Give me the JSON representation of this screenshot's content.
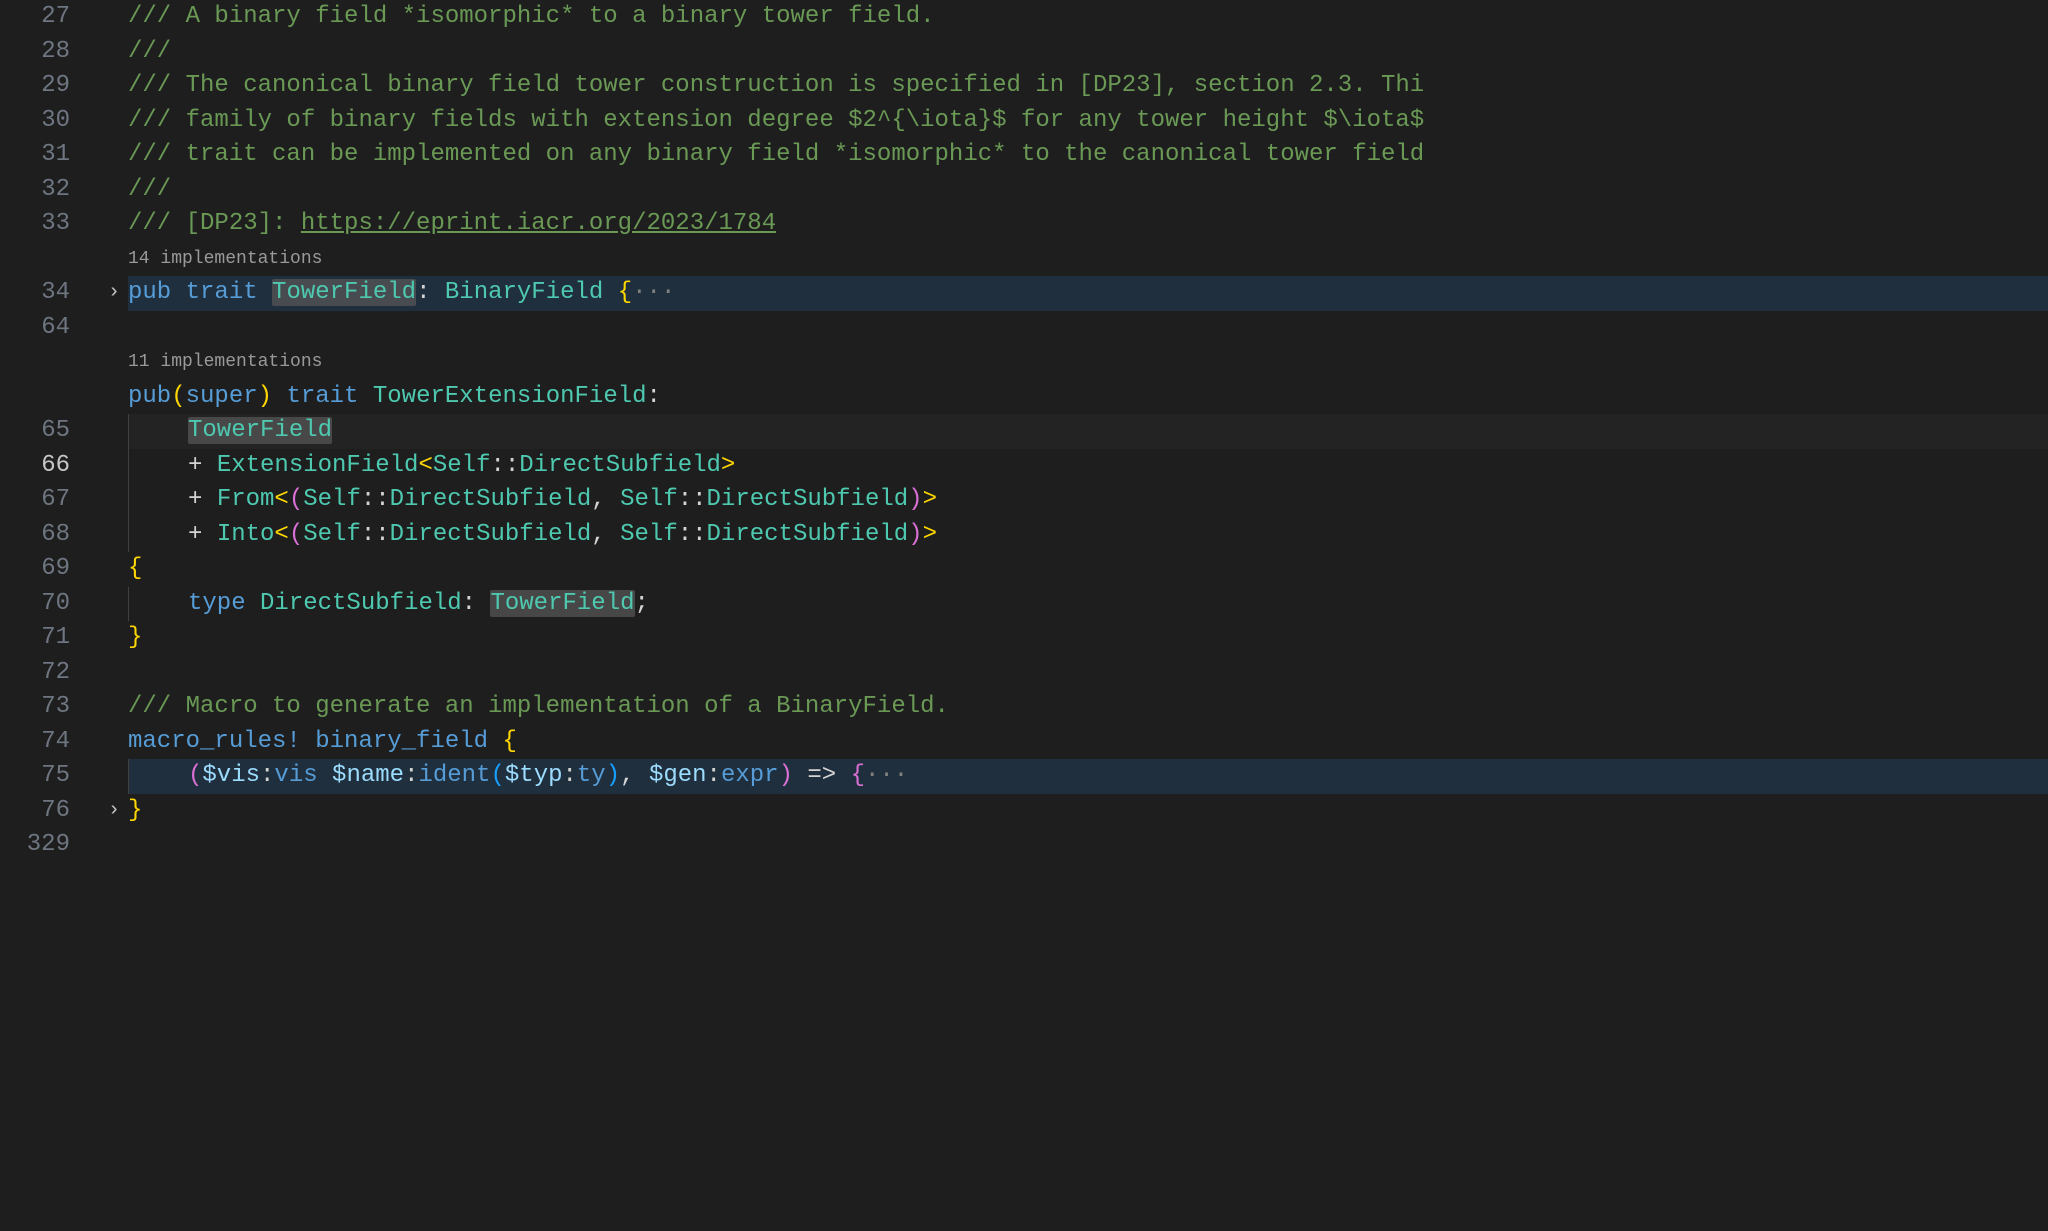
{
  "gutter": {
    "lines": [
      "27",
      "28",
      "29",
      "30",
      "31",
      "32",
      "33",
      "",
      "34",
      "64",
      "",
      "",
      "65",
      "66",
      "67",
      "68",
      "69",
      "70",
      "71",
      "72",
      "73",
      "74",
      "75",
      "76",
      "329"
    ],
    "activeIndex": 13
  },
  "fold": {
    "chevron": "›",
    "rows": [
      8,
      23
    ]
  },
  "codelens": {
    "impl14": "14 implementations",
    "impl11": "11 implementations"
  },
  "code": {
    "l27": "/// A binary field *isomorphic* to a binary tower field.",
    "l28": "///",
    "l29": "/// The canonical binary field tower construction is specified in [DP23], section 2.3. Thi",
    "l30": "/// family of binary fields with extension degree $2^{\\iota}$ for any tower height $\\iota$",
    "l31": "/// trait can be implemented on any binary field *isomorphic* to the canonical tower field",
    "l32": "///",
    "l33a": "/// [DP23]: ",
    "l33b": "https://eprint.iacr.org/2023/1784",
    "l34": {
      "pub": "pub",
      "trait": "trait",
      "name": "TowerField",
      "colon": ": ",
      "base": "BinaryField",
      "open": " {",
      "dots": "···"
    },
    "l65": {
      "pub": "pub",
      "po": "(",
      "super": "super",
      "pc": ")",
      "trait": " trait ",
      "name": "TowerExtensionField",
      "colon": ":"
    },
    "l66": "TowerField",
    "l67": {
      "plus": "+ ",
      "ext": "ExtensionField",
      "lt": "<",
      "self": "Self",
      "cc": "::",
      "dsub": "DirectSubfield",
      "gt": ">"
    },
    "l68": {
      "plus": "+ ",
      "from": "From",
      "lt": "<",
      "po": "(",
      "self": "Self",
      "cc": "::",
      "dsub": "DirectSubfield",
      "comma": ", ",
      "pc": ")",
      "gt": ">"
    },
    "l69": {
      "plus": "+ ",
      "into": "Into",
      "lt": "<",
      "po": "(",
      "self": "Self",
      "cc": "::",
      "dsub": "DirectSubfield",
      "comma": ", ",
      "pc": ")",
      "gt": ">"
    },
    "l70": "{",
    "l71": {
      "type": "type ",
      "name": "DirectSubfield",
      "colon": ": ",
      "tw": "TowerField",
      "semi": ";"
    },
    "l72": "}",
    "l74": "/// Macro to generate an implementation of a BinaryField.",
    "l75": {
      "mr": "macro_rules!",
      "sp": " ",
      "name": "binary_field",
      "sp2": " ",
      "open": "{"
    },
    "l76": {
      "po": "(",
      "d1": "$vis",
      "c1": ":",
      "k1": "vis",
      "sp": " ",
      "d2": "$name",
      "c2": ":",
      "k2": "ident",
      "po2": "(",
      "d3": "$typ",
      "c3": ":",
      "k3": "ty",
      "pc2": ")",
      "comma": ", ",
      "d4": "$gen",
      "c4": ":",
      "k4": "expr",
      "pc": ")",
      "arrow": " => ",
      "open": "{",
      "dots": "···"
    },
    "l329": "}"
  }
}
